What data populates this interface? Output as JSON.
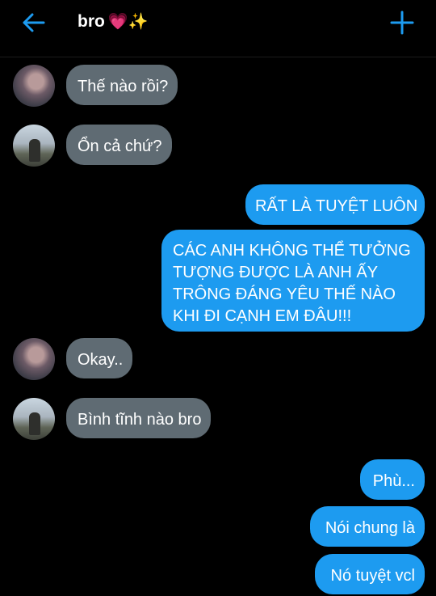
{
  "header": {
    "title": "bro",
    "title_emoji": "💗✨",
    "back_icon": "back-arrow-icon",
    "add_icon": "plus-icon",
    "accent_color": "#1d9bf0"
  },
  "colors": {
    "incoming_bubble": "#5f6b73",
    "outgoing_bubble": "#1d9bf0",
    "background": "#000000"
  },
  "messages": [
    {
      "side": "in",
      "text": "Thế nào rồi?"
    },
    {
      "side": "in",
      "text": "Ổn cả chứ?"
    },
    {
      "side": "out",
      "text": "RẤT LÀ TUYỆT LUÔN"
    },
    {
      "side": "out",
      "text": "CÁC ANH KHÔNG THỂ TƯỞNG TƯỢNG ĐƯỢC LÀ ANH ẤY TRÔNG ĐÁNG YÊU THẾ NÀO KHI ĐI CẠNH EM ĐÂU!!!"
    },
    {
      "side": "in",
      "text": "Okay.."
    },
    {
      "side": "in",
      "text": "Bình tĩnh nào bro"
    },
    {
      "side": "out",
      "text": "Phù..."
    },
    {
      "side": "out",
      "text": "Nói chung là"
    },
    {
      "side": "out",
      "text": "Nó tuyệt vcl"
    }
  ]
}
